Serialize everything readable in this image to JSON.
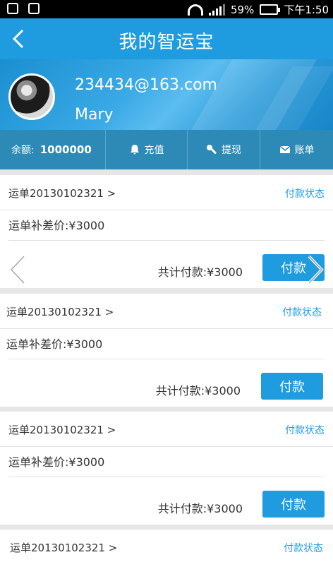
{
  "status_bar": {
    "battery": "59%",
    "time": "下午1:50",
    "sim_badge": "1"
  },
  "header": {
    "title": "我的智运宝"
  },
  "profile": {
    "email": "234434@163.com",
    "name": "Mary"
  },
  "account_bar": {
    "balance_label": "余额:",
    "balance_value": "1000000",
    "recharge_label": "充值",
    "withdraw_label": "提现",
    "bill_label": "账单"
  },
  "orders": [
    {
      "order_no": "运单20130102321 >",
      "status_link": "付款状态",
      "diff_text": "运单补差价:¥3000",
      "total_text": "共计付款:¥3000",
      "pay_label": "付款"
    },
    {
      "order_no": "运单20130102321 >",
      "status_link": "付款状态",
      "diff_text": "运单补差价:¥3000",
      "total_text": "共计付款:¥3000",
      "pay_label": "付款"
    },
    {
      "order_no": "运单20130102321 >",
      "status_link": "付款状态",
      "diff_text": "运单补差价:¥3000",
      "total_text": "共计付款:¥3000",
      "pay_label": "付款"
    },
    {
      "order_no": "运单20130102321 >",
      "status_link": "付款状态"
    }
  ],
  "colors": {
    "primary": "#1f9be0",
    "account_bar": "#2d89b5"
  }
}
